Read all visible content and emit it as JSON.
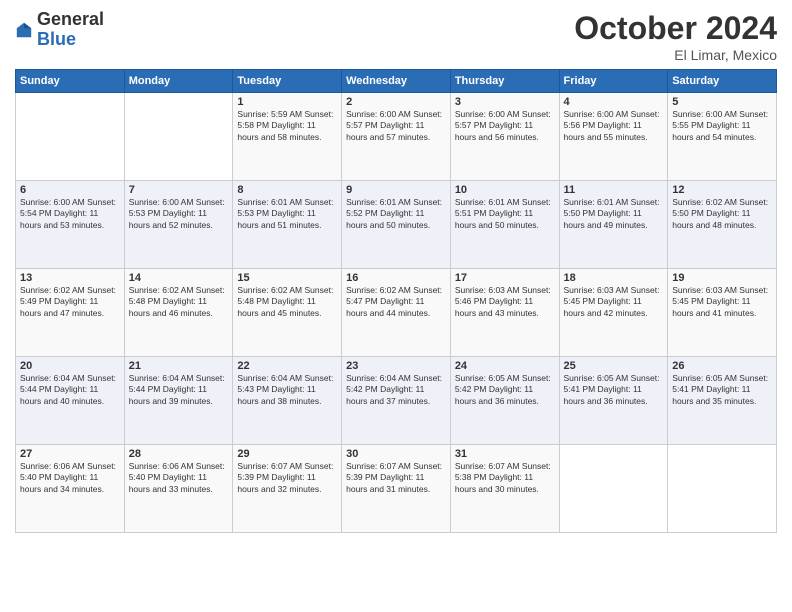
{
  "header": {
    "logo_general": "General",
    "logo_blue": "Blue",
    "month": "October 2024",
    "location": "El Limar, Mexico"
  },
  "days_of_week": [
    "Sunday",
    "Monday",
    "Tuesday",
    "Wednesday",
    "Thursday",
    "Friday",
    "Saturday"
  ],
  "weeks": [
    [
      {
        "day": "",
        "info": ""
      },
      {
        "day": "",
        "info": ""
      },
      {
        "day": "1",
        "info": "Sunrise: 5:59 AM\nSunset: 5:58 PM\nDaylight: 11 hours and 58 minutes."
      },
      {
        "day": "2",
        "info": "Sunrise: 6:00 AM\nSunset: 5:57 PM\nDaylight: 11 hours and 57 minutes."
      },
      {
        "day": "3",
        "info": "Sunrise: 6:00 AM\nSunset: 5:57 PM\nDaylight: 11 hours and 56 minutes."
      },
      {
        "day": "4",
        "info": "Sunrise: 6:00 AM\nSunset: 5:56 PM\nDaylight: 11 hours and 55 minutes."
      },
      {
        "day": "5",
        "info": "Sunrise: 6:00 AM\nSunset: 5:55 PM\nDaylight: 11 hours and 54 minutes."
      }
    ],
    [
      {
        "day": "6",
        "info": "Sunrise: 6:00 AM\nSunset: 5:54 PM\nDaylight: 11 hours and 53 minutes."
      },
      {
        "day": "7",
        "info": "Sunrise: 6:00 AM\nSunset: 5:53 PM\nDaylight: 11 hours and 52 minutes."
      },
      {
        "day": "8",
        "info": "Sunrise: 6:01 AM\nSunset: 5:53 PM\nDaylight: 11 hours and 51 minutes."
      },
      {
        "day": "9",
        "info": "Sunrise: 6:01 AM\nSunset: 5:52 PM\nDaylight: 11 hours and 50 minutes."
      },
      {
        "day": "10",
        "info": "Sunrise: 6:01 AM\nSunset: 5:51 PM\nDaylight: 11 hours and 50 minutes."
      },
      {
        "day": "11",
        "info": "Sunrise: 6:01 AM\nSunset: 5:50 PM\nDaylight: 11 hours and 49 minutes."
      },
      {
        "day": "12",
        "info": "Sunrise: 6:02 AM\nSunset: 5:50 PM\nDaylight: 11 hours and 48 minutes."
      }
    ],
    [
      {
        "day": "13",
        "info": "Sunrise: 6:02 AM\nSunset: 5:49 PM\nDaylight: 11 hours and 47 minutes."
      },
      {
        "day": "14",
        "info": "Sunrise: 6:02 AM\nSunset: 5:48 PM\nDaylight: 11 hours and 46 minutes."
      },
      {
        "day": "15",
        "info": "Sunrise: 6:02 AM\nSunset: 5:48 PM\nDaylight: 11 hours and 45 minutes."
      },
      {
        "day": "16",
        "info": "Sunrise: 6:02 AM\nSunset: 5:47 PM\nDaylight: 11 hours and 44 minutes."
      },
      {
        "day": "17",
        "info": "Sunrise: 6:03 AM\nSunset: 5:46 PM\nDaylight: 11 hours and 43 minutes."
      },
      {
        "day": "18",
        "info": "Sunrise: 6:03 AM\nSunset: 5:45 PM\nDaylight: 11 hours and 42 minutes."
      },
      {
        "day": "19",
        "info": "Sunrise: 6:03 AM\nSunset: 5:45 PM\nDaylight: 11 hours and 41 minutes."
      }
    ],
    [
      {
        "day": "20",
        "info": "Sunrise: 6:04 AM\nSunset: 5:44 PM\nDaylight: 11 hours and 40 minutes."
      },
      {
        "day": "21",
        "info": "Sunrise: 6:04 AM\nSunset: 5:44 PM\nDaylight: 11 hours and 39 minutes."
      },
      {
        "day": "22",
        "info": "Sunrise: 6:04 AM\nSunset: 5:43 PM\nDaylight: 11 hours and 38 minutes."
      },
      {
        "day": "23",
        "info": "Sunrise: 6:04 AM\nSunset: 5:42 PM\nDaylight: 11 hours and 37 minutes."
      },
      {
        "day": "24",
        "info": "Sunrise: 6:05 AM\nSunset: 5:42 PM\nDaylight: 11 hours and 36 minutes."
      },
      {
        "day": "25",
        "info": "Sunrise: 6:05 AM\nSunset: 5:41 PM\nDaylight: 11 hours and 36 minutes."
      },
      {
        "day": "26",
        "info": "Sunrise: 6:05 AM\nSunset: 5:41 PM\nDaylight: 11 hours and 35 minutes."
      }
    ],
    [
      {
        "day": "27",
        "info": "Sunrise: 6:06 AM\nSunset: 5:40 PM\nDaylight: 11 hours and 34 minutes."
      },
      {
        "day": "28",
        "info": "Sunrise: 6:06 AM\nSunset: 5:40 PM\nDaylight: 11 hours and 33 minutes."
      },
      {
        "day": "29",
        "info": "Sunrise: 6:07 AM\nSunset: 5:39 PM\nDaylight: 11 hours and 32 minutes."
      },
      {
        "day": "30",
        "info": "Sunrise: 6:07 AM\nSunset: 5:39 PM\nDaylight: 11 hours and 31 minutes."
      },
      {
        "day": "31",
        "info": "Sunrise: 6:07 AM\nSunset: 5:38 PM\nDaylight: 11 hours and 30 minutes."
      },
      {
        "day": "",
        "info": ""
      },
      {
        "day": "",
        "info": ""
      }
    ]
  ]
}
